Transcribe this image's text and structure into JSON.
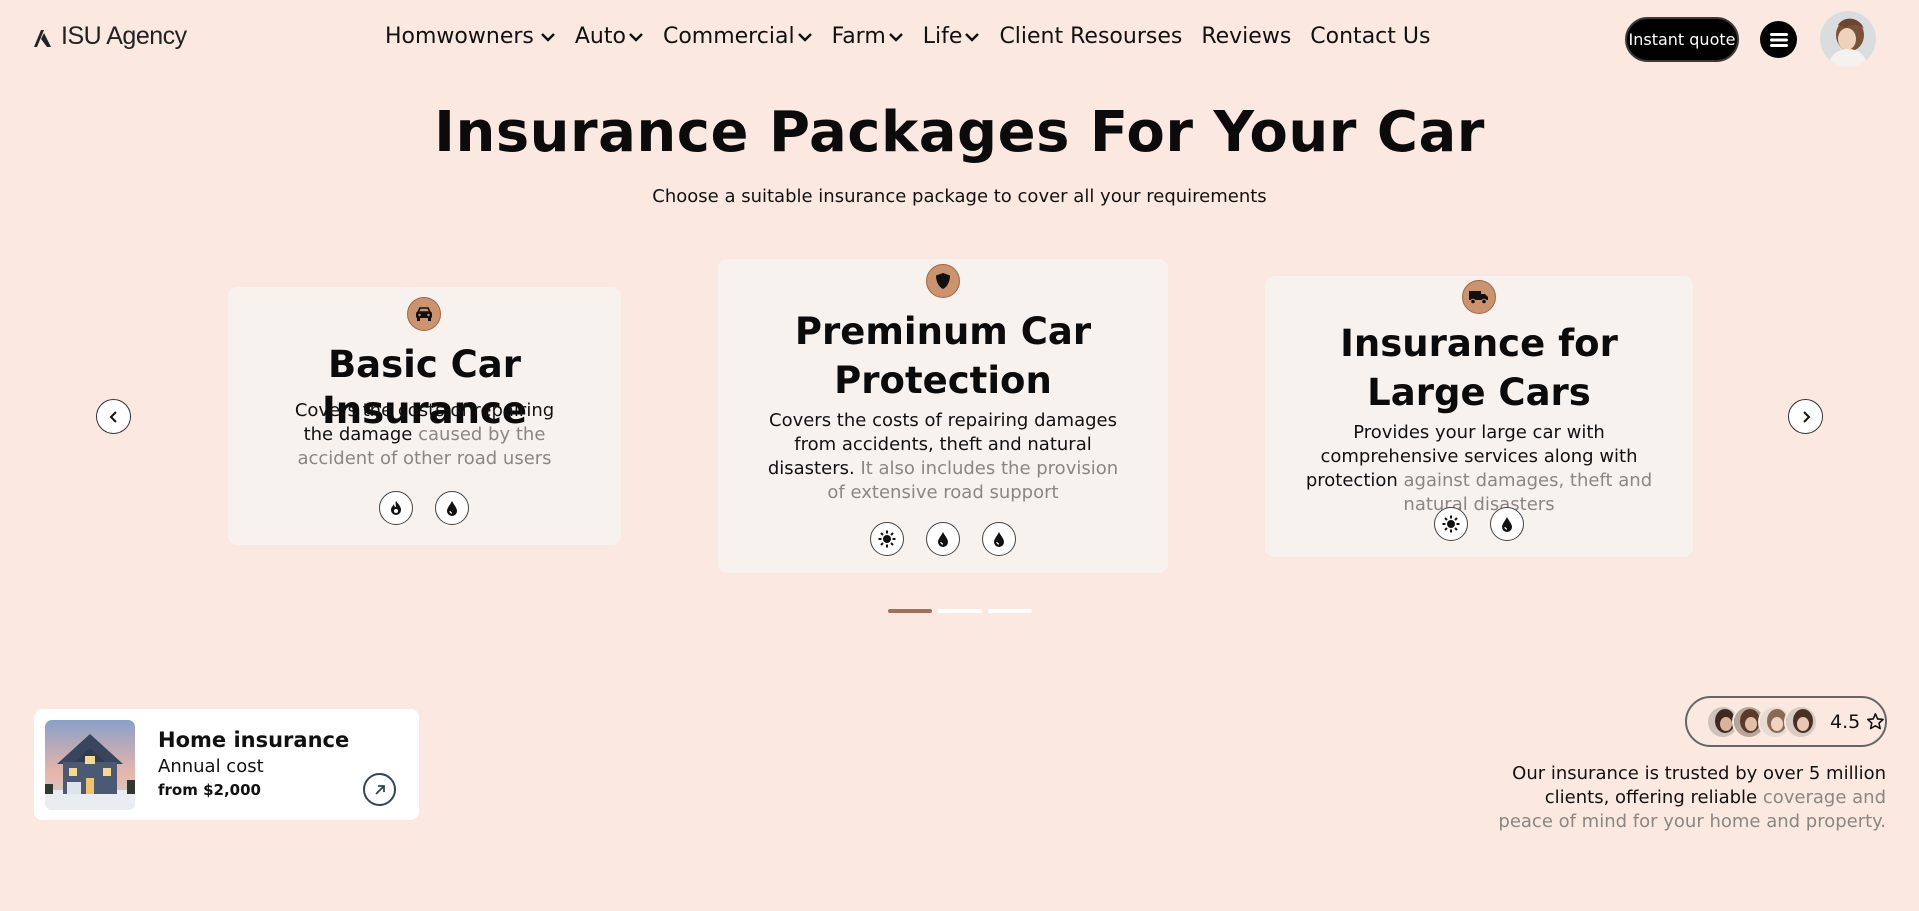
{
  "header": {
    "logo_text": "ISU Agency",
    "nav": [
      {
        "label": "Homwowners",
        "dropdown": true
      },
      {
        "label": "Auto",
        "dropdown": true
      },
      {
        "label": "Commercial",
        "dropdown": true
      },
      {
        "label": "Farm",
        "dropdown": true
      },
      {
        "label": "Life",
        "dropdown": true
      },
      {
        "label": "Client Resourses",
        "dropdown": false
      },
      {
        "label": "Reviews",
        "dropdown": false
      },
      {
        "label": "Contact Us",
        "dropdown": false
      }
    ],
    "quote_button": "Instant quote",
    "menu_icon": "hamburger-icon"
  },
  "hero": {
    "title": "Insurance Packages For Your Car",
    "subtitle": "Choose a suitable insurance package to cover all your requirements"
  },
  "cards": [
    {
      "icon": "car-icon",
      "title": "Basic Car Insurance",
      "desc_main": "Covers the costs of repairing the damage",
      "desc_muted": "caused by the accident of other road users",
      "features": [
        "fire-icon",
        "water-drop-icon"
      ]
    },
    {
      "icon": "shield-icon",
      "title": "Preminum Car Protection",
      "desc_main": "Covers the costs of repairing damages from accidents, theft and natural disasters.",
      "desc_muted": "It also includes the provision of extensive road support",
      "features": [
        "sun-icon",
        "water-drop-icon",
        "water-drop-icon"
      ]
    },
    {
      "icon": "truck-icon",
      "title": "Insurance for Large Cars",
      "desc_main": "Provides your large car with comprehensive services along with protection",
      "desc_muted": "against damages, theft and natural disasters",
      "features": [
        "sun-icon",
        "water-drop-icon"
      ]
    }
  ],
  "carousel": {
    "active_index": 0,
    "count": 3
  },
  "home_card": {
    "title": "Home insurance",
    "subtitle": "Annual cost",
    "price": "from $2,000"
  },
  "rating": {
    "value": "4.5"
  },
  "trust": {
    "main": "Our insurance is trusted by over 5 million clients, offering reliable",
    "muted": "coverage and peace of mind for your home and property."
  },
  "colors": {
    "background": "#fbe9e1",
    "card": "#f8f2ef",
    "accent": "#cc936f",
    "dot_active": "#a0705a",
    "muted_text": "#8b8583"
  }
}
